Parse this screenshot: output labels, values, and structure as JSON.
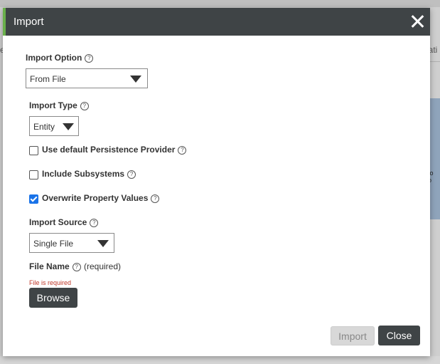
{
  "background": {
    "left_fragment": "e",
    "right_fragment": "lati",
    "panel_text": "to\no"
  },
  "dialog": {
    "title": "Import",
    "close_icon": "close-icon",
    "accent_color": "#6ab04c",
    "header_color": "#3f4446"
  },
  "import_option": {
    "label": "Import Option",
    "help": "?",
    "value": "From File"
  },
  "import_type": {
    "label": "Import Type",
    "help": "?",
    "value": "Entity"
  },
  "options": [
    {
      "label": "Use default Persistence Provider",
      "help": "?",
      "checked": false
    },
    {
      "label": "Include Subsystems",
      "help": "?",
      "checked": false
    },
    {
      "label": "Overwrite Property Values",
      "help": "?",
      "checked": true
    }
  ],
  "import_source": {
    "label": "Import Source",
    "help": "?",
    "value": "Single File"
  },
  "file_name": {
    "label": "File Name",
    "help": "?",
    "required": "(required)",
    "error": "File is required"
  },
  "buttons": {
    "browse": "Browse",
    "import": "Import",
    "close": "Close"
  }
}
